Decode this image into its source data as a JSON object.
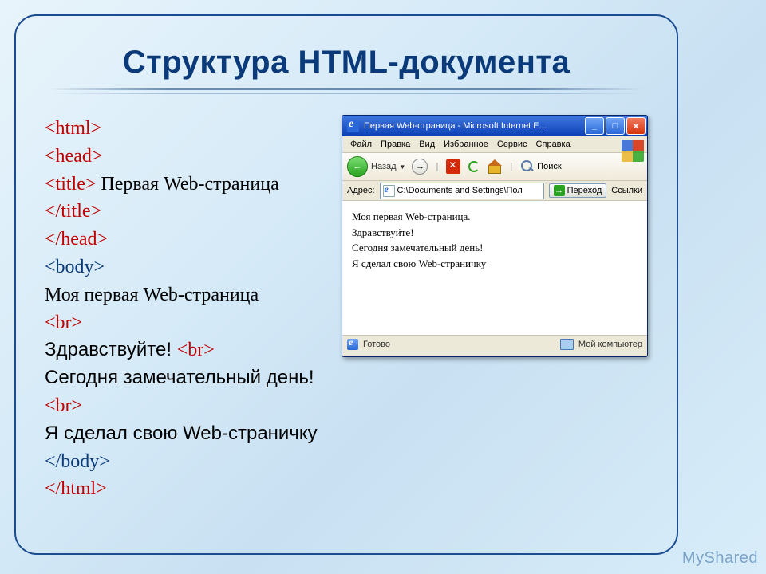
{
  "slide": {
    "title": "Структура HTML-документа"
  },
  "code": {
    "l1": "<html>",
    "l2": "<head>",
    "l3_tag": "<title>",
    "l3_text": " Первая  Web-страница",
    "l4": "</title>",
    "l5": "</head>",
    "l6": "<body>",
    "l7": "Моя первая Web-страница",
    "l8": "<br>",
    "l9": "Здравствуйте! ",
    "l9_tag": "<br>",
    "l10": "Сегодня замечательный день! ",
    "l10_tag": "<br>",
    "l11": "Я сделал свою Web-страничку",
    "l12": "</body>",
    "l13": "</html>"
  },
  "browser": {
    "title": "Первая Web-страница - Microsoft Internet E...",
    "menu": {
      "m1": "Файл",
      "m2": "Правка",
      "m3": "Вид",
      "m4": "Избранное",
      "m5": "Сервис",
      "m6": "Справка"
    },
    "toolbar": {
      "back": "Назад",
      "search": "Поиск"
    },
    "addressbar": {
      "label": "Адрес:",
      "path": "C:\\Documents and Settings\\Пол",
      "go": "Переход",
      "links": "Ссылки"
    },
    "page": {
      "p1": "Моя первая Web-страница.",
      "p2": "Здравствуйте!",
      "p3": "Сегодня замечательный день!",
      "p4": "Я сделал свою Web-страничку"
    },
    "statusbar": {
      "ready": "Готово",
      "location": "Мой компьютер"
    },
    "winbuttons": {
      "min": "_",
      "max": "□",
      "close": "✕"
    }
  },
  "watermark": "MyShared"
}
